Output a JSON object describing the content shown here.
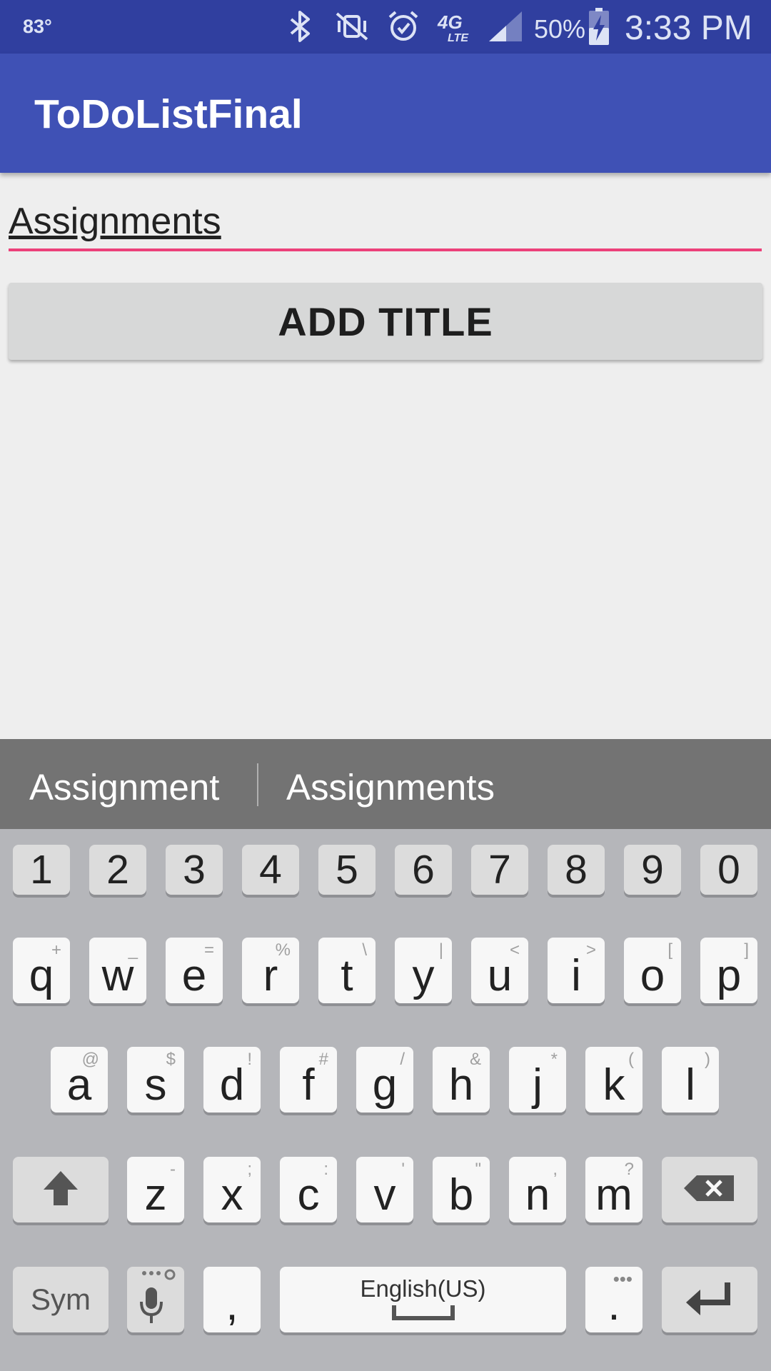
{
  "status_bar": {
    "temperature": "83°",
    "battery": "50%",
    "time": "3:33 PM",
    "icons": [
      "bluetooth-icon",
      "vibrate-off-icon",
      "alarm-icon",
      "4g-lte-icon",
      "signal-icon",
      "battery-charging-icon"
    ]
  },
  "app_bar": {
    "title": "ToDoListFinal"
  },
  "form": {
    "input_value": "Assignments",
    "button_label": "ADD TITLE"
  },
  "suggestions": [
    "Assignment",
    "Assignments"
  ],
  "keyboard": {
    "number_row": [
      "1",
      "2",
      "3",
      "4",
      "5",
      "6",
      "7",
      "8",
      "9",
      "0"
    ],
    "row1": [
      {
        "key": "q",
        "hint": "+"
      },
      {
        "key": "w",
        "hint": "_"
      },
      {
        "key": "e",
        "hint": "="
      },
      {
        "key": "r",
        "hint": "%"
      },
      {
        "key": "t",
        "hint": "\\"
      },
      {
        "key": "y",
        "hint": "|"
      },
      {
        "key": "u",
        "hint": "<"
      },
      {
        "key": "i",
        "hint": ">"
      },
      {
        "key": "o",
        "hint": "["
      },
      {
        "key": "p",
        "hint": "]"
      }
    ],
    "row2": [
      {
        "key": "a",
        "hint": "@"
      },
      {
        "key": "s",
        "hint": "$"
      },
      {
        "key": "d",
        "hint": "!"
      },
      {
        "key": "f",
        "hint": "#"
      },
      {
        "key": "g",
        "hint": "/"
      },
      {
        "key": "h",
        "hint": "&"
      },
      {
        "key": "j",
        "hint": "*"
      },
      {
        "key": "k",
        "hint": "("
      },
      {
        "key": "l",
        "hint": ")"
      }
    ],
    "row3": [
      {
        "key": "z",
        "hint": "-"
      },
      {
        "key": "x",
        "hint": ";"
      },
      {
        "key": "c",
        "hint": ":"
      },
      {
        "key": "v",
        "hint": "'"
      },
      {
        "key": "b",
        "hint": "\""
      },
      {
        "key": "n",
        "hint": ","
      },
      {
        "key": "m",
        "hint": "?"
      }
    ],
    "sym_label": "Sym",
    "comma": ",",
    "period": ".",
    "space_label": "English(US)"
  },
  "colors": {
    "status_bar": "#303f9f",
    "app_bar": "#3f51b5",
    "accent": "#ec407a",
    "keyboard_bg": "#b5b6ba",
    "suggestion_bar": "#737373"
  }
}
